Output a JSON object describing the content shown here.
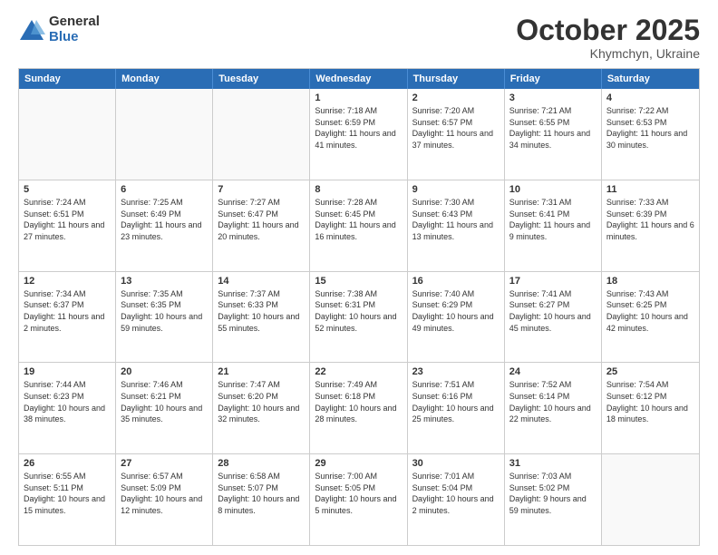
{
  "logo": {
    "general": "General",
    "blue": "Blue"
  },
  "header": {
    "month": "October 2025",
    "location": "Khymchyn, Ukraine"
  },
  "days_of_week": [
    "Sunday",
    "Monday",
    "Tuesday",
    "Wednesday",
    "Thursday",
    "Friday",
    "Saturday"
  ],
  "weeks": [
    [
      {
        "day": "",
        "empty": true
      },
      {
        "day": "",
        "empty": true
      },
      {
        "day": "",
        "empty": true
      },
      {
        "day": "1",
        "sunrise": "7:18 AM",
        "sunset": "6:59 PM",
        "daylight": "11 hours and 41 minutes."
      },
      {
        "day": "2",
        "sunrise": "7:20 AM",
        "sunset": "6:57 PM",
        "daylight": "11 hours and 37 minutes."
      },
      {
        "day": "3",
        "sunrise": "7:21 AM",
        "sunset": "6:55 PM",
        "daylight": "11 hours and 34 minutes."
      },
      {
        "day": "4",
        "sunrise": "7:22 AM",
        "sunset": "6:53 PM",
        "daylight": "11 hours and 30 minutes."
      }
    ],
    [
      {
        "day": "5",
        "sunrise": "7:24 AM",
        "sunset": "6:51 PM",
        "daylight": "11 hours and 27 minutes."
      },
      {
        "day": "6",
        "sunrise": "7:25 AM",
        "sunset": "6:49 PM",
        "daylight": "11 hours and 23 minutes."
      },
      {
        "day": "7",
        "sunrise": "7:27 AM",
        "sunset": "6:47 PM",
        "daylight": "11 hours and 20 minutes."
      },
      {
        "day": "8",
        "sunrise": "7:28 AM",
        "sunset": "6:45 PM",
        "daylight": "11 hours and 16 minutes."
      },
      {
        "day": "9",
        "sunrise": "7:30 AM",
        "sunset": "6:43 PM",
        "daylight": "11 hours and 13 minutes."
      },
      {
        "day": "10",
        "sunrise": "7:31 AM",
        "sunset": "6:41 PM",
        "daylight": "11 hours and 9 minutes."
      },
      {
        "day": "11",
        "sunrise": "7:33 AM",
        "sunset": "6:39 PM",
        "daylight": "11 hours and 6 minutes."
      }
    ],
    [
      {
        "day": "12",
        "sunrise": "7:34 AM",
        "sunset": "6:37 PM",
        "daylight": "11 hours and 2 minutes."
      },
      {
        "day": "13",
        "sunrise": "7:35 AM",
        "sunset": "6:35 PM",
        "daylight": "10 hours and 59 minutes."
      },
      {
        "day": "14",
        "sunrise": "7:37 AM",
        "sunset": "6:33 PM",
        "daylight": "10 hours and 55 minutes."
      },
      {
        "day": "15",
        "sunrise": "7:38 AM",
        "sunset": "6:31 PM",
        "daylight": "10 hours and 52 minutes."
      },
      {
        "day": "16",
        "sunrise": "7:40 AM",
        "sunset": "6:29 PM",
        "daylight": "10 hours and 49 minutes."
      },
      {
        "day": "17",
        "sunrise": "7:41 AM",
        "sunset": "6:27 PM",
        "daylight": "10 hours and 45 minutes."
      },
      {
        "day": "18",
        "sunrise": "7:43 AM",
        "sunset": "6:25 PM",
        "daylight": "10 hours and 42 minutes."
      }
    ],
    [
      {
        "day": "19",
        "sunrise": "7:44 AM",
        "sunset": "6:23 PM",
        "daylight": "10 hours and 38 minutes."
      },
      {
        "day": "20",
        "sunrise": "7:46 AM",
        "sunset": "6:21 PM",
        "daylight": "10 hours and 35 minutes."
      },
      {
        "day": "21",
        "sunrise": "7:47 AM",
        "sunset": "6:20 PM",
        "daylight": "10 hours and 32 minutes."
      },
      {
        "day": "22",
        "sunrise": "7:49 AM",
        "sunset": "6:18 PM",
        "daylight": "10 hours and 28 minutes."
      },
      {
        "day": "23",
        "sunrise": "7:51 AM",
        "sunset": "6:16 PM",
        "daylight": "10 hours and 25 minutes."
      },
      {
        "day": "24",
        "sunrise": "7:52 AM",
        "sunset": "6:14 PM",
        "daylight": "10 hours and 22 minutes."
      },
      {
        "day": "25",
        "sunrise": "7:54 AM",
        "sunset": "6:12 PM",
        "daylight": "10 hours and 18 minutes."
      }
    ],
    [
      {
        "day": "26",
        "sunrise": "6:55 AM",
        "sunset": "5:11 PM",
        "daylight": "10 hours and 15 minutes."
      },
      {
        "day": "27",
        "sunrise": "6:57 AM",
        "sunset": "5:09 PM",
        "daylight": "10 hours and 12 minutes."
      },
      {
        "day": "28",
        "sunrise": "6:58 AM",
        "sunset": "5:07 PM",
        "daylight": "10 hours and 8 minutes."
      },
      {
        "day": "29",
        "sunrise": "7:00 AM",
        "sunset": "5:05 PM",
        "daylight": "10 hours and 5 minutes."
      },
      {
        "day": "30",
        "sunrise": "7:01 AM",
        "sunset": "5:04 PM",
        "daylight": "10 hours and 2 minutes."
      },
      {
        "day": "31",
        "sunrise": "7:03 AM",
        "sunset": "5:02 PM",
        "daylight": "9 hours and 59 minutes."
      },
      {
        "day": "",
        "empty": true
      }
    ]
  ]
}
